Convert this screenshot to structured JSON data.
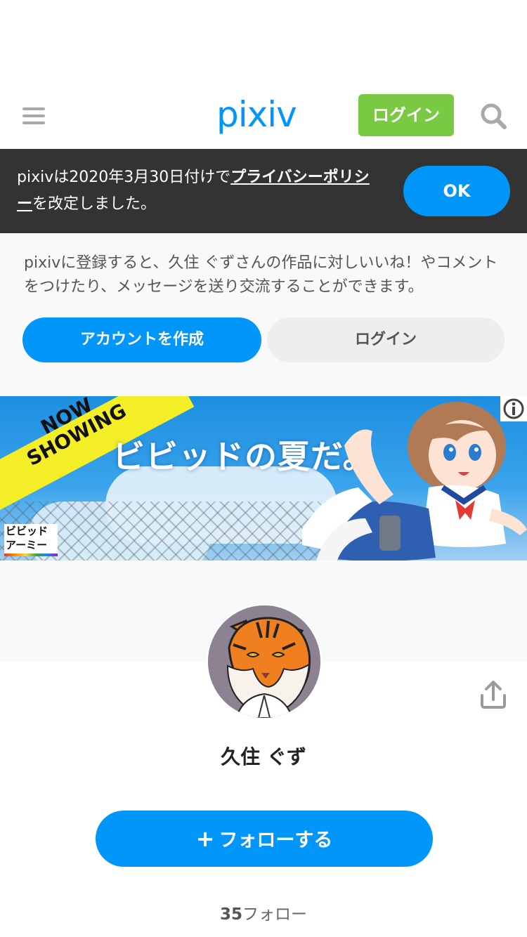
{
  "header": {
    "logo_text": "pixiv",
    "login_label": "ログイン",
    "menu_icon": "hamburger-menu-icon",
    "search_icon": "search-icon",
    "login_color": "#7ac943",
    "brand_color": "#0096fa"
  },
  "notice": {
    "text_before": "pixivは2020年3月30日付けで",
    "link_text": "プライバシーポリシー",
    "text_after": "を改定しました。",
    "ok_label": "OK"
  },
  "register": {
    "message": "pixivに登録すると、久住 ぐずさんの作品に対しいいね！やコメントをつけたり、メッセージを送り交流することができます。",
    "create_account_label": "アカウントを作成",
    "login_label": "ログイン"
  },
  "ad": {
    "badge_text": "NOW SHOWING",
    "headline": "ビビッドの夏だ。",
    "logo_line1": "ビビッド",
    "logo_line2": "アーミー",
    "info_icon": "info-icon"
  },
  "profile": {
    "name": "久住 ぐず",
    "follow_label": "フォローする",
    "follow_icon": "plus-icon",
    "share_icon": "share-icon",
    "following_count": "35",
    "following_label": "フォロー"
  }
}
